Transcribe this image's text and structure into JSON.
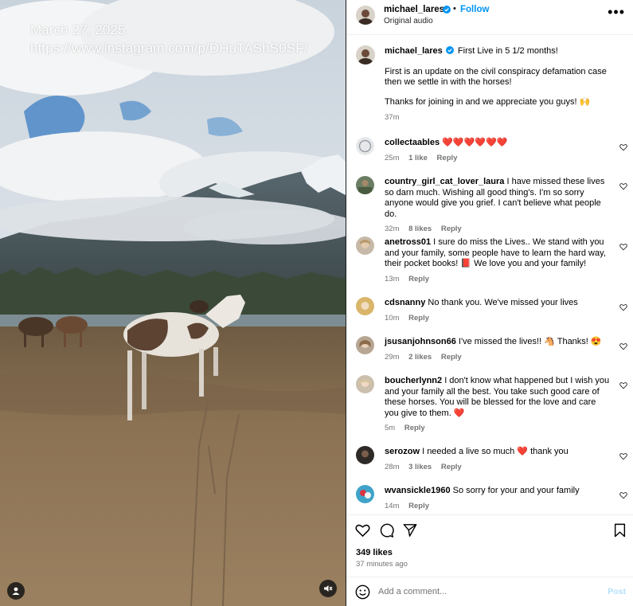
{
  "overlay": {
    "date": "March 27, 2025",
    "url": "https://www.instagram.com/p/DHuTAShS0SF/"
  },
  "header": {
    "username": "michael_lares",
    "separator": "•",
    "follow_label": "Follow",
    "audio": "Original audio",
    "more_icon": "more-horizontal-icon"
  },
  "caption": {
    "username": "michael_lares",
    "title": "First Live in 5 1/2 months!",
    "paragraph1": "First is an update on the civil conspiracy defamation case then we settle in with the horses!",
    "paragraph2": "Thanks for joining in and we appreciate you guys! 🙌",
    "time": "37m"
  },
  "comments": [
    {
      "username": "collectaables",
      "text": "❤️❤️❤️❤️❤️❤️",
      "time": "25m",
      "likes": "1 like",
      "reply": "Reply"
    },
    {
      "username": "country_girl_cat_lover_laura",
      "text": "I have missed these lives so darn much. Wishing all good thing's. I'm so sorry anyone would give you grief. I can't believe what people do.",
      "time": "32m",
      "likes": "8 likes",
      "reply": "Reply"
    },
    {
      "username": "anetross01",
      "text": "I sure do miss the Lives.. We stand with you and your family, some people have to learn the hard way, their pocket books! 📕 We love you and your family!",
      "time": "13m",
      "likes": "",
      "reply": "Reply"
    },
    {
      "username": "cdsnanny",
      "text": "No thank you. We've missed your lives",
      "time": "10m",
      "likes": "",
      "reply": "Reply"
    },
    {
      "username": "jsusanjohnson66",
      "text": "I've missed the lives!! 🐴 Thanks! 😍",
      "time": "29m",
      "likes": "2 likes",
      "reply": "Reply"
    },
    {
      "username": "boucherlynn2",
      "text": "I don't know what happened but I wish you and your family all the best. You take such good care of these horses. You will be blessed for the love and care you give to them. ❤️",
      "time": "5m",
      "likes": "",
      "reply": "Reply"
    },
    {
      "username": "serozow",
      "text": "I needed a live so much ❤️ thank you",
      "time": "28m",
      "likes": "3 likes",
      "reply": "Reply"
    },
    {
      "username": "wvansickle1960",
      "text": "So sorry for your and your family",
      "time": "14m",
      "likes": "",
      "reply": "Reply"
    }
  ],
  "actions": {
    "likes": "349 likes",
    "time": "37 minutes ago"
  },
  "comment_box": {
    "placeholder": "Add a comment...",
    "post_label": "Post"
  },
  "colors": {
    "accent": "#0095f6",
    "heart_red": "#ed4956",
    "muted": "#737373"
  }
}
